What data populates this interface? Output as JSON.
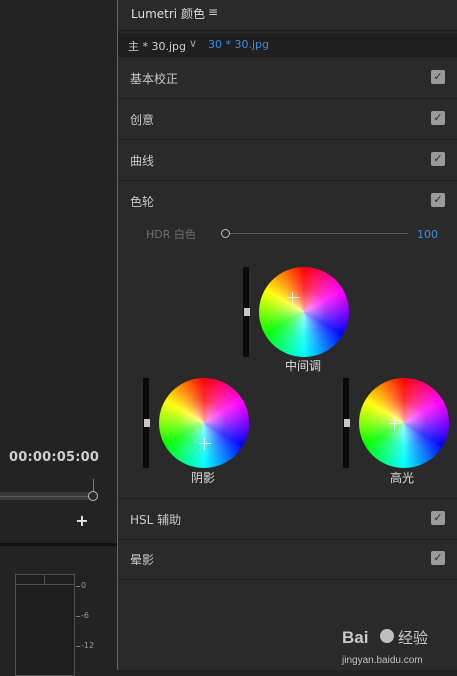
{
  "left": {
    "timecode": "00:00:05:00",
    "add_symbol": "+",
    "meter_labels": [
      "0",
      "-6",
      "-12"
    ]
  },
  "panel": {
    "title": "Lumetri 颜色",
    "menu_icon": "≡",
    "master_clip": "主 * 30.jpg",
    "chevron": "∨",
    "sequence_clip": "30 * 30.jpg",
    "sections_top": [
      {
        "label": "基本校正",
        "checked": true
      },
      {
        "label": "创意",
        "checked": true
      },
      {
        "label": "曲线",
        "checked": true
      },
      {
        "label": "色轮",
        "checked": true
      }
    ],
    "hdr": {
      "label": "HDR 白色",
      "value": "100"
    },
    "wheels": {
      "midtones": "中间调",
      "shadows": "阴影",
      "highlights": "高光"
    },
    "sections_bottom": [
      {
        "label": "HSL 辅助",
        "checked": true
      },
      {
        "label": "晕影",
        "checked": true
      }
    ],
    "check_glyph": "✓"
  },
  "watermark": {
    "brand": "Bai",
    "brand2": "经验",
    "url": "jingyan.baidu.com"
  },
  "colors": {
    "accent": "#3e8ee0",
    "panel_bg": "#2a2a2a",
    "border": "#3b6fb0"
  }
}
